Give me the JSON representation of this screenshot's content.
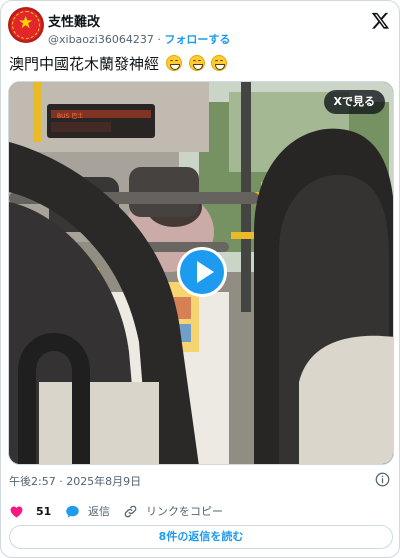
{
  "author": {
    "display_name": "支性難改",
    "handle": "@xibaozi36064237",
    "separator": "·",
    "follow_label": "フォローする",
    "avatar_icon": "flag-star-avatar"
  },
  "tweet": {
    "text": "澳門中國花木蘭發神經",
    "emojis": [
      "grinning-face-icon",
      "grinning-face-icon",
      "grinning-face-icon"
    ]
  },
  "media": {
    "view_on_x_label": "Xで見る",
    "type": "video",
    "play_icon": "play-icon",
    "bus_sign_text": "BUS 巴士"
  },
  "meta": {
    "timestamp": "午後2:57 · 2025年8月9日"
  },
  "actions": {
    "like_count": "51",
    "reply_label": "返信",
    "copy_link_label": "リンクをコピー"
  },
  "read_replies_label": "8件の返信を読む",
  "colors": {
    "accent": "#1d9bf0",
    "like": "#f91880",
    "text": "#0f1419",
    "secondary": "#536471",
    "border": "#cfd9de"
  }
}
